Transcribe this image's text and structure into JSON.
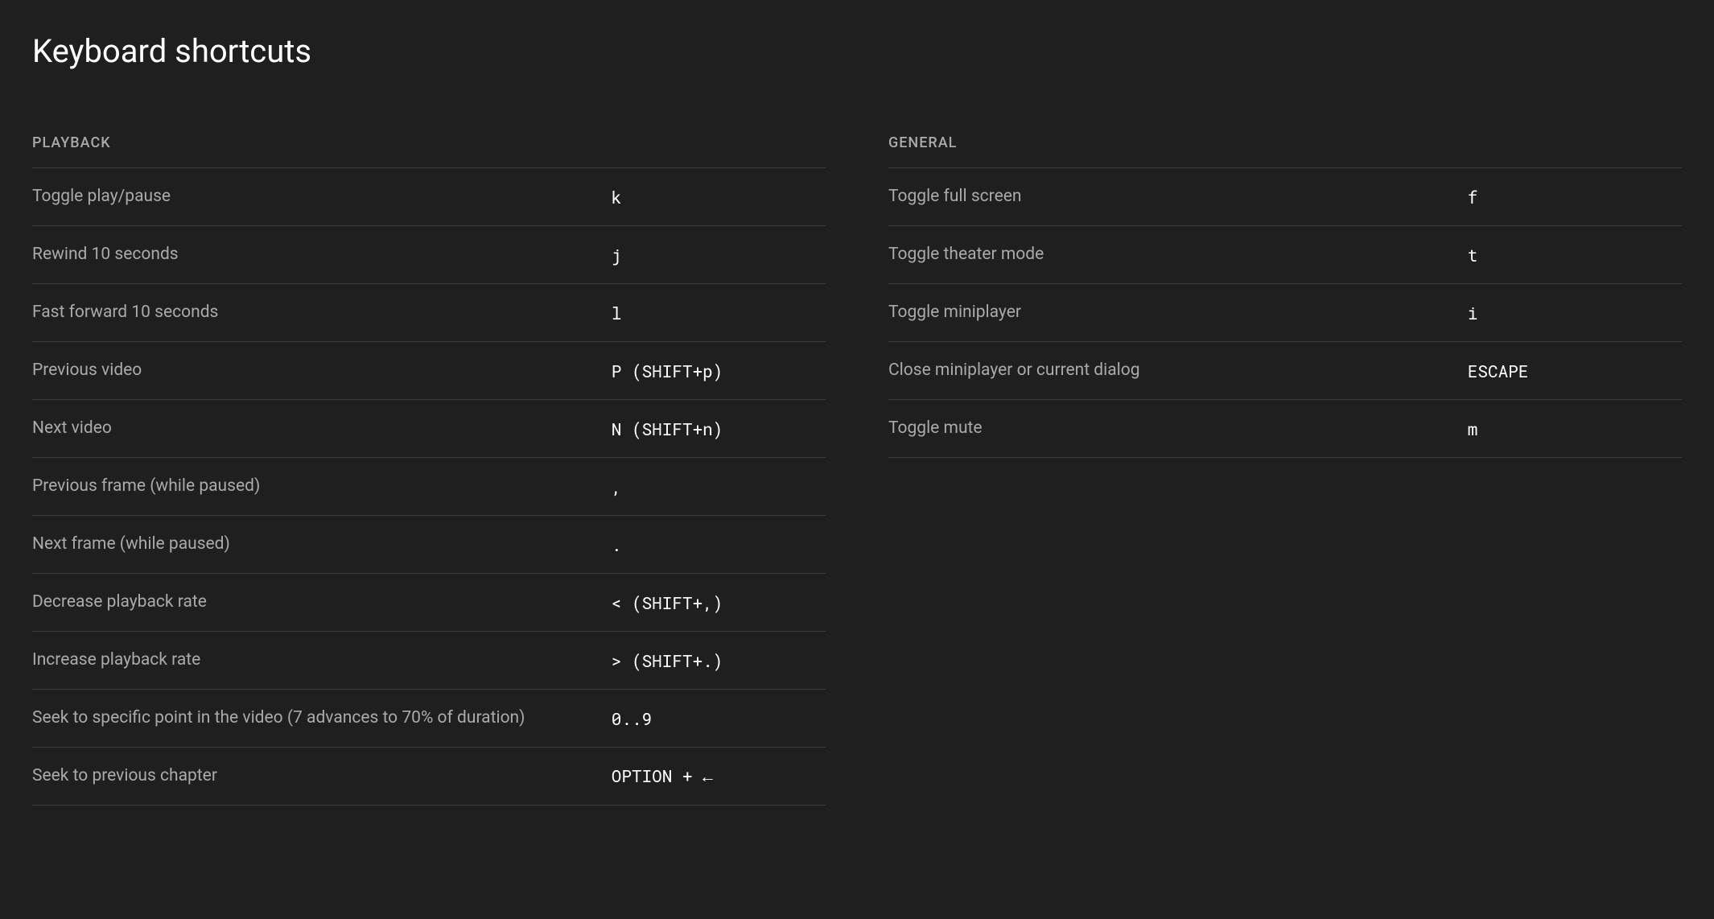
{
  "title": "Keyboard shortcuts",
  "sections": {
    "playback": {
      "header": "PLAYBACK",
      "items": [
        {
          "label": "Toggle play/pause",
          "key": "k"
        },
        {
          "label": "Rewind 10 seconds",
          "key": "j"
        },
        {
          "label": "Fast forward 10 seconds",
          "key": "l"
        },
        {
          "label": "Previous video",
          "key": "P (SHIFT+p)"
        },
        {
          "label": "Next video",
          "key": "N (SHIFT+n)"
        },
        {
          "label": "Previous frame (while paused)",
          "key": ","
        },
        {
          "label": "Next frame (while paused)",
          "key": "."
        },
        {
          "label": "Decrease playback rate",
          "key": "< (SHIFT+,)"
        },
        {
          "label": "Increase playback rate",
          "key": "> (SHIFT+.)"
        },
        {
          "label": "Seek to specific point in the video (7 advances to 70% of duration)",
          "key": "0..9"
        },
        {
          "label": "Seek to previous chapter",
          "key": "OPTION + ←"
        }
      ]
    },
    "general": {
      "header": "GENERAL",
      "items": [
        {
          "label": "Toggle full screen",
          "key": "f"
        },
        {
          "label": "Toggle theater mode",
          "key": "t"
        },
        {
          "label": "Toggle miniplayer",
          "key": "i"
        },
        {
          "label": "Close miniplayer or current dialog",
          "key": "ESCAPE"
        },
        {
          "label": "Toggle mute",
          "key": "m"
        }
      ]
    }
  }
}
